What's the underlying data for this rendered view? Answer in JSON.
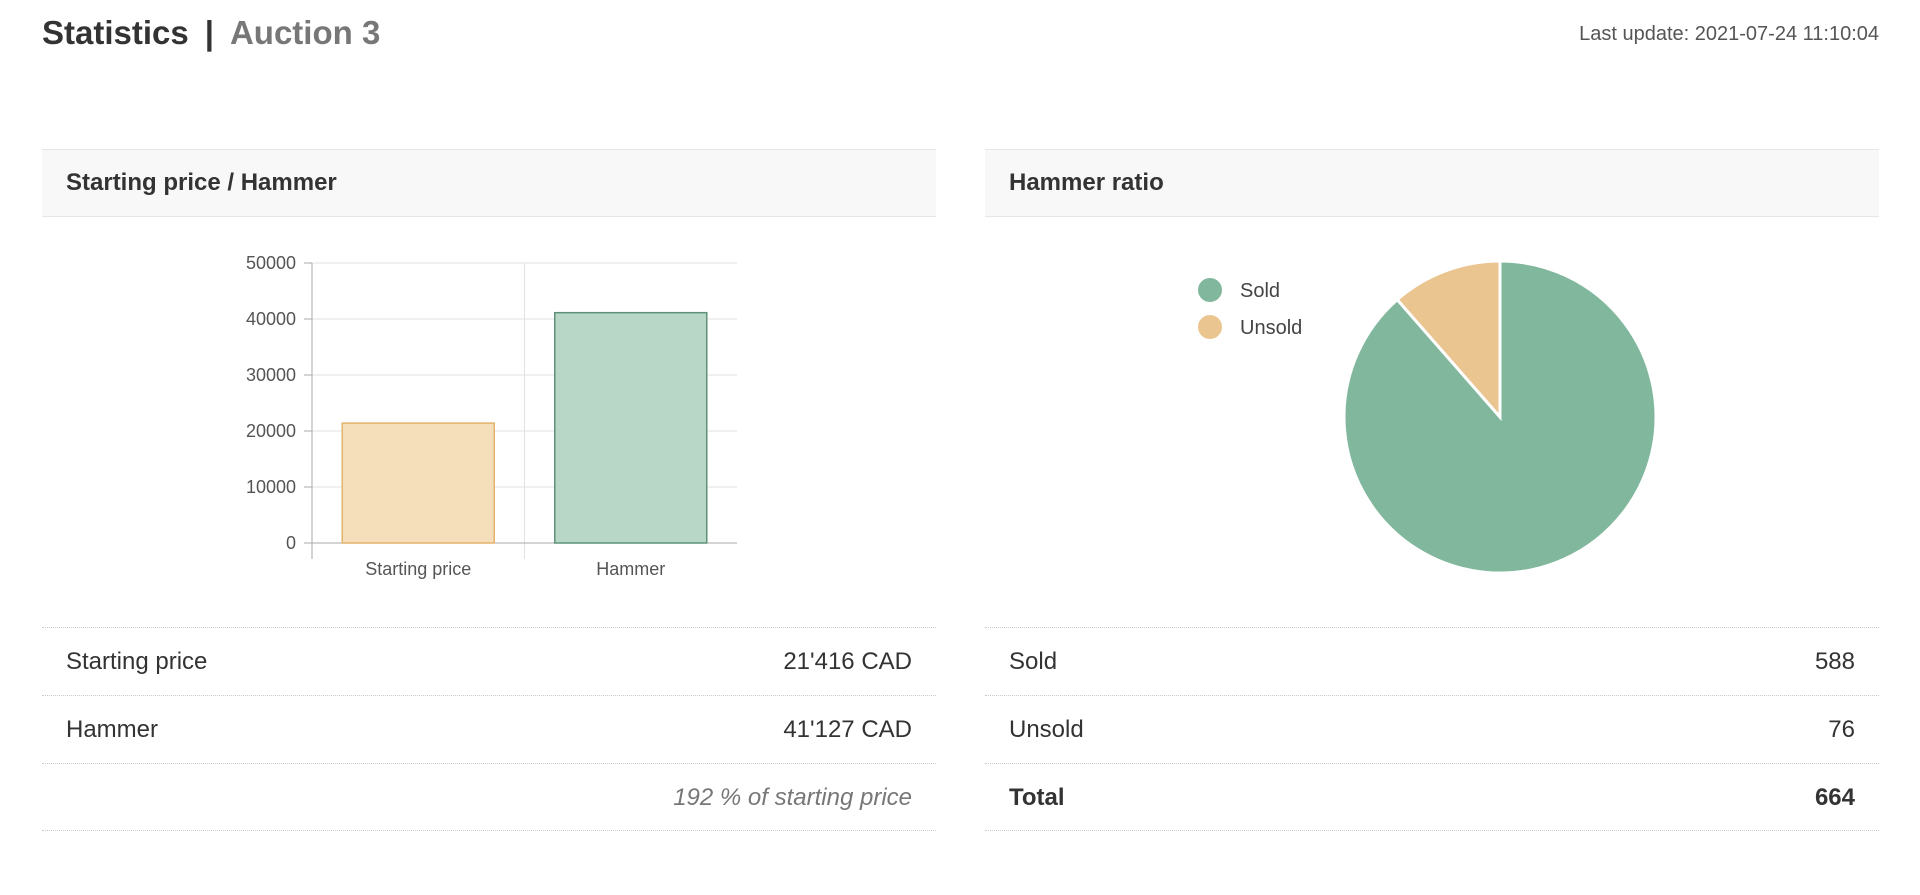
{
  "header": {
    "title": "Statistics",
    "separator": "|",
    "subtitle": "Auction 3",
    "last_update": "Last update: 2021-07-24 11:10:04"
  },
  "colors": {
    "starting_price": "#f5deba",
    "starting_price_border": "#e2b46c",
    "hammer": "#b8d7c7",
    "hammer_border": "#5d9278",
    "sold": "#80b79d",
    "unsold": "#ebc590"
  },
  "price_panel": {
    "heading": "Starting price / Hammer",
    "rows": [
      {
        "label": "Starting price",
        "value": "21'416 CAD"
      },
      {
        "label": "Hammer",
        "value": "41'127 CAD"
      },
      {
        "label": "",
        "value": "192 % of starting price"
      }
    ]
  },
  "ratio_panel": {
    "heading": "Hammer ratio",
    "rows": [
      {
        "label": "Sold",
        "value": "588"
      },
      {
        "label": "Unsold",
        "value": "76"
      },
      {
        "label": "Total",
        "value": "664"
      }
    ]
  },
  "chart_data": [
    {
      "type": "bar",
      "categories": [
        "Starting price",
        "Hammer"
      ],
      "values": [
        21416,
        41127
      ],
      "yticks": [
        "0",
        "10000",
        "20000",
        "30000",
        "40000",
        "50000"
      ],
      "ylim": [
        0,
        50000
      ],
      "grid": true,
      "colors": [
        "#f5deba",
        "#b8d7c7"
      ]
    },
    {
      "type": "pie",
      "labels": [
        "Sold",
        "Unsold"
      ],
      "values": [
        588,
        76
      ],
      "colors": [
        "#80b79d",
        "#ebc590"
      ],
      "legend": "left"
    }
  ]
}
